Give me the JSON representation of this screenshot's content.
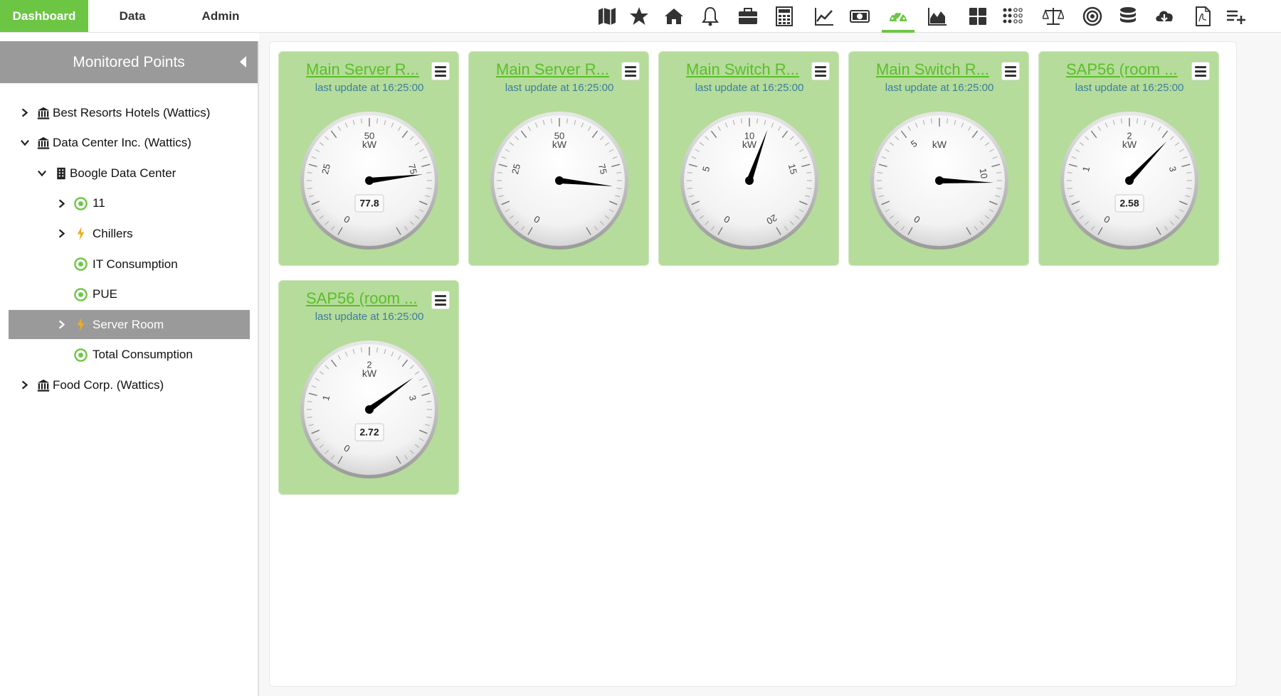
{
  "nav": {
    "tabs": [
      {
        "label": "Dashboard",
        "active": true
      },
      {
        "label": "Data",
        "active": false
      },
      {
        "label": "Admin",
        "active": false
      }
    ],
    "toolbar_icons": [
      "map-icon",
      "star-icon",
      "home-icon",
      "bell-icon",
      "briefcase-icon",
      "calculator-icon",
      "line-chart-icon",
      "money-icon",
      "gauge-icon",
      "area-chart-icon",
      "grid-icon",
      "dots-grid-icon",
      "scale-icon",
      "target-icon",
      "database-icon",
      "cloud-download-icon",
      "pdf-icon",
      "add-list-icon"
    ],
    "active_icon": "gauge-icon",
    "accent_color": "#6cc644"
  },
  "sidebar": {
    "title": "Monitored Points",
    "items": [
      {
        "label": "Best Resorts Hotels (Wattics)",
        "icon": "bank-icon",
        "expander": "collapsed",
        "depth": 0
      },
      {
        "label": "Data Center Inc. (Wattics)",
        "icon": "bank-icon",
        "expander": "expanded",
        "depth": 0
      },
      {
        "label": "Boogle Data Center",
        "icon": "building-icon",
        "expander": "expanded",
        "depth": 1
      },
      {
        "label": "11",
        "icon": "meter-icon",
        "expander": "collapsed",
        "depth": 2
      },
      {
        "label": "Chillers",
        "icon": "bolt-icon",
        "expander": "collapsed",
        "depth": 2
      },
      {
        "label": "IT Consumption",
        "icon": "meter-icon",
        "expander": "none",
        "depth": 2
      },
      {
        "label": "PUE",
        "icon": "meter-icon",
        "expander": "none",
        "depth": 2
      },
      {
        "label": "Server Room",
        "icon": "bolt-icon",
        "expander": "collapsed",
        "depth": 2,
        "selected": true
      },
      {
        "label": "Total Consumption",
        "icon": "meter-icon",
        "expander": "none",
        "depth": 2
      },
      {
        "label": "Food Corp. (Wattics)",
        "icon": "bank-icon",
        "expander": "collapsed",
        "depth": 0
      }
    ]
  },
  "widgets": [
    {
      "title": "Main Server R...",
      "updated": "last update at 16:25:00",
      "unit": "kW",
      "min": 0,
      "max": 100,
      "ticks": [
        "0",
        "25",
        "50",
        "75"
      ],
      "value": 77.8,
      "value_label": "77.8"
    },
    {
      "title": "Main Server R...",
      "updated": "last update at 16:25:00",
      "unit": "kW",
      "min": 0,
      "max": 100,
      "ticks": [
        "0",
        "25",
        "50",
        "75"
      ],
      "value": 82,
      "value_label": null
    },
    {
      "title": "Main Switch R...",
      "updated": "last update at 16:25:00",
      "unit": "kW",
      "min": 0,
      "max": 20,
      "ticks": [
        "0",
        "5",
        "10",
        "15",
        "20"
      ],
      "value": 11.3,
      "value_label": null
    },
    {
      "title": "Main Switch R...",
      "updated": "last update at 16:25:00",
      "unit": "kW",
      "min": 0,
      "max": 13,
      "ticks": [
        "0",
        "5",
        "10"
      ],
      "value": 10.5,
      "value_label": null
    },
    {
      "title": "SAP56 (room ...",
      "updated": "last update at 16:25:00",
      "unit": "kW",
      "min": 0,
      "max": 4,
      "ticks": [
        "0",
        "1",
        "2",
        "3"
      ],
      "value": 2.58,
      "value_label": "2.58"
    },
    {
      "title": "SAP56 (room ...",
      "updated": "last update at 16:25:00",
      "unit": "kW",
      "min": 0,
      "max": 4,
      "ticks": [
        "0",
        "1",
        "2",
        "3"
      ],
      "value": 2.72,
      "value_label": "2.72"
    }
  ]
}
